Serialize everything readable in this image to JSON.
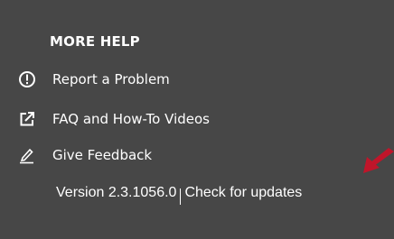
{
  "help_panel": {
    "heading": "MORE HELP",
    "items": [
      {
        "label": "Report a Problem",
        "icon": "exclamation-circle-icon"
      },
      {
        "label": "FAQ and How-To Videos",
        "icon": "external-link-icon"
      },
      {
        "label": "Give Feedback",
        "icon": "pencil-icon"
      }
    ],
    "version_text": "Version 2.3.1056.0",
    "update_link": "Check for updates"
  },
  "colors": {
    "background": "#474747",
    "text": "#ffffff",
    "annotation_arrow": "#c0152a"
  }
}
